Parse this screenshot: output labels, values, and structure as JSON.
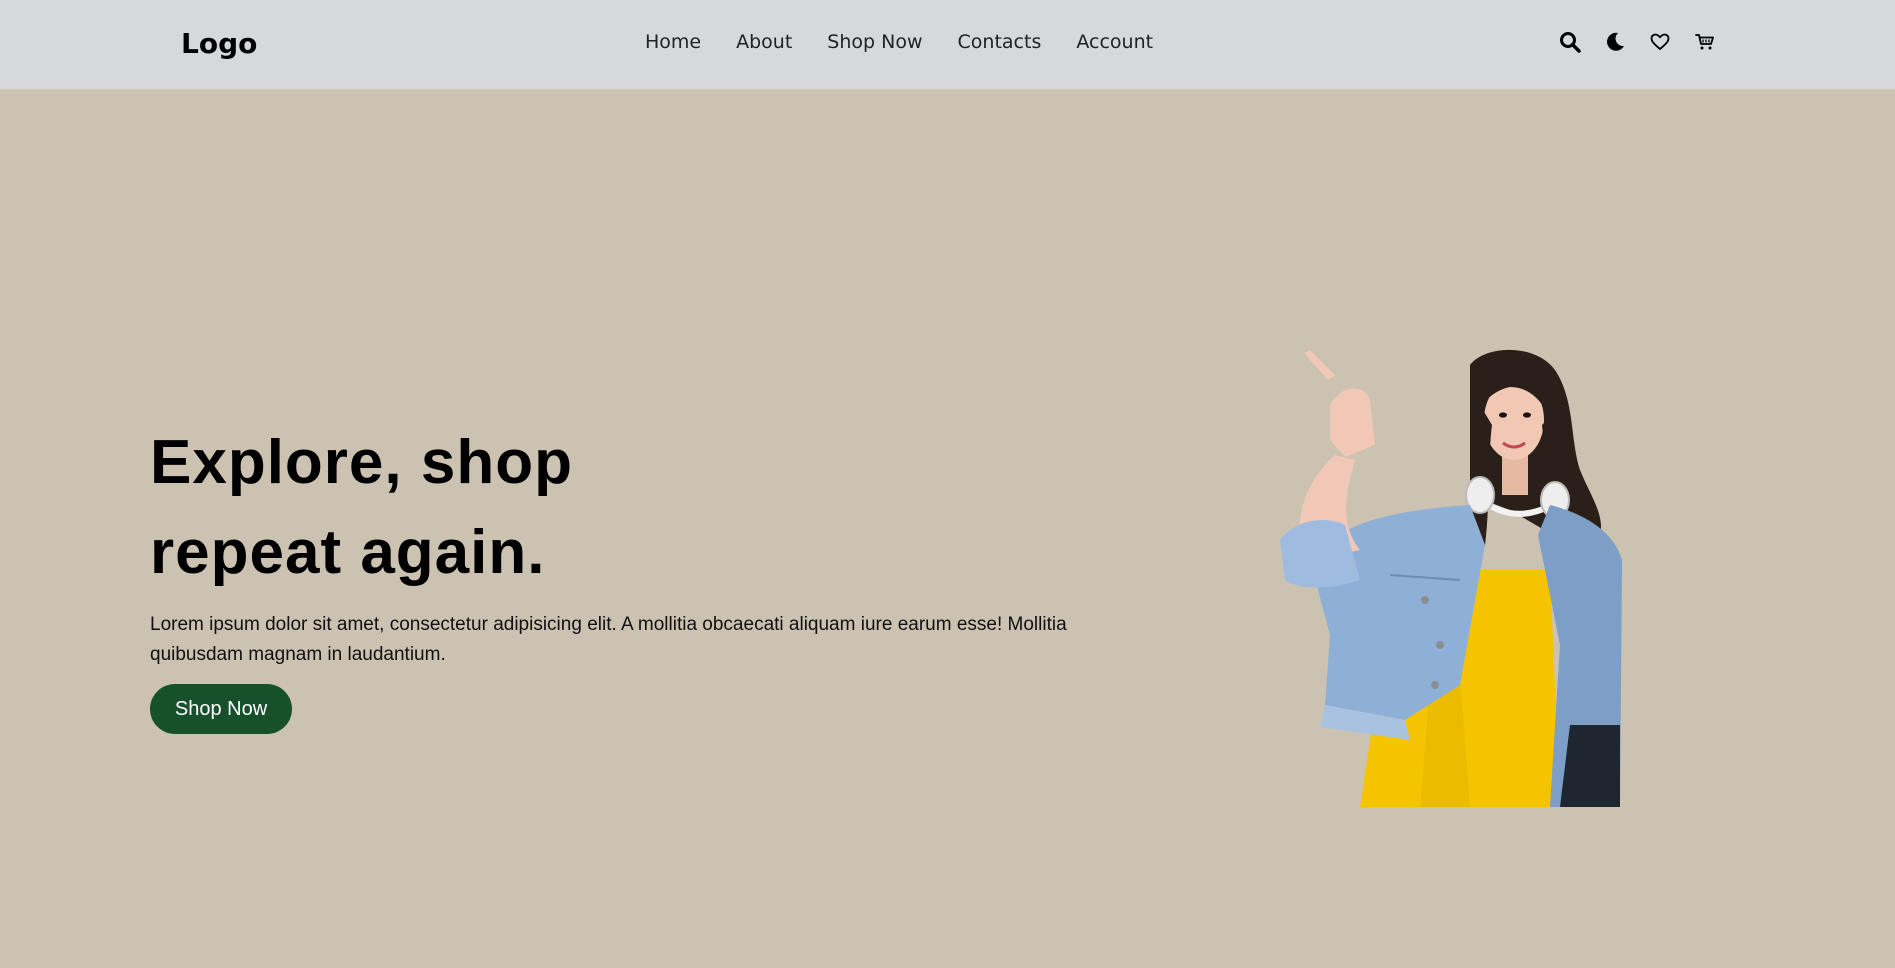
{
  "header": {
    "logo": "Logo",
    "nav": [
      "Home",
      "About",
      "Shop Now",
      "Contacts",
      "Account"
    ],
    "icons": [
      "search-icon",
      "moon-icon",
      "heart-icon",
      "cart-icon"
    ]
  },
  "hero": {
    "title_line1": "Explore, shop",
    "title_line2": "repeat again.",
    "text": "Lorem ipsum dolor sit amet, consectetur adipisicing elit. A mollitia obcaecati aliquam iure earum esse! Mollitia quibusdam magnam in laudantium.",
    "button_label": "Shop Now"
  },
  "colors": {
    "page_bg": "#cbc2b1",
    "nav_bg": "#d6d8dc",
    "button_bg": "#17512c",
    "button_text": "#ffffff"
  }
}
